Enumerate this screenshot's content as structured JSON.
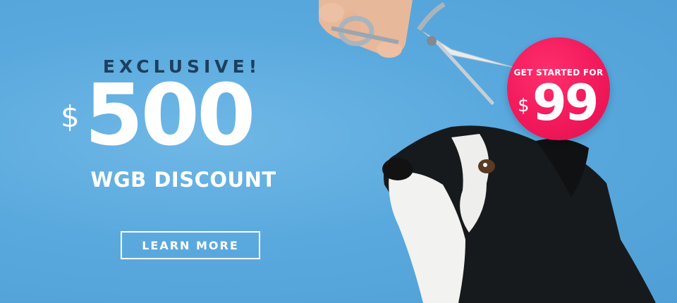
{
  "promo": {
    "eyebrow": "EXCLUSIVE!",
    "currency_symbol": "$",
    "amount": "500",
    "subhead": "WGB DISCOUNT",
    "cta_label": "LEARN MORE"
  },
  "badge": {
    "label": "GET STARTED FOR",
    "currency_symbol": "$",
    "amount": "99"
  },
  "colors": {
    "background": "#5aa9de",
    "eyebrow": "#1d3f5e",
    "badge": "#f0185a",
    "text": "#ffffff"
  },
  "photo": {
    "subject": "dog-with-scissors"
  }
}
